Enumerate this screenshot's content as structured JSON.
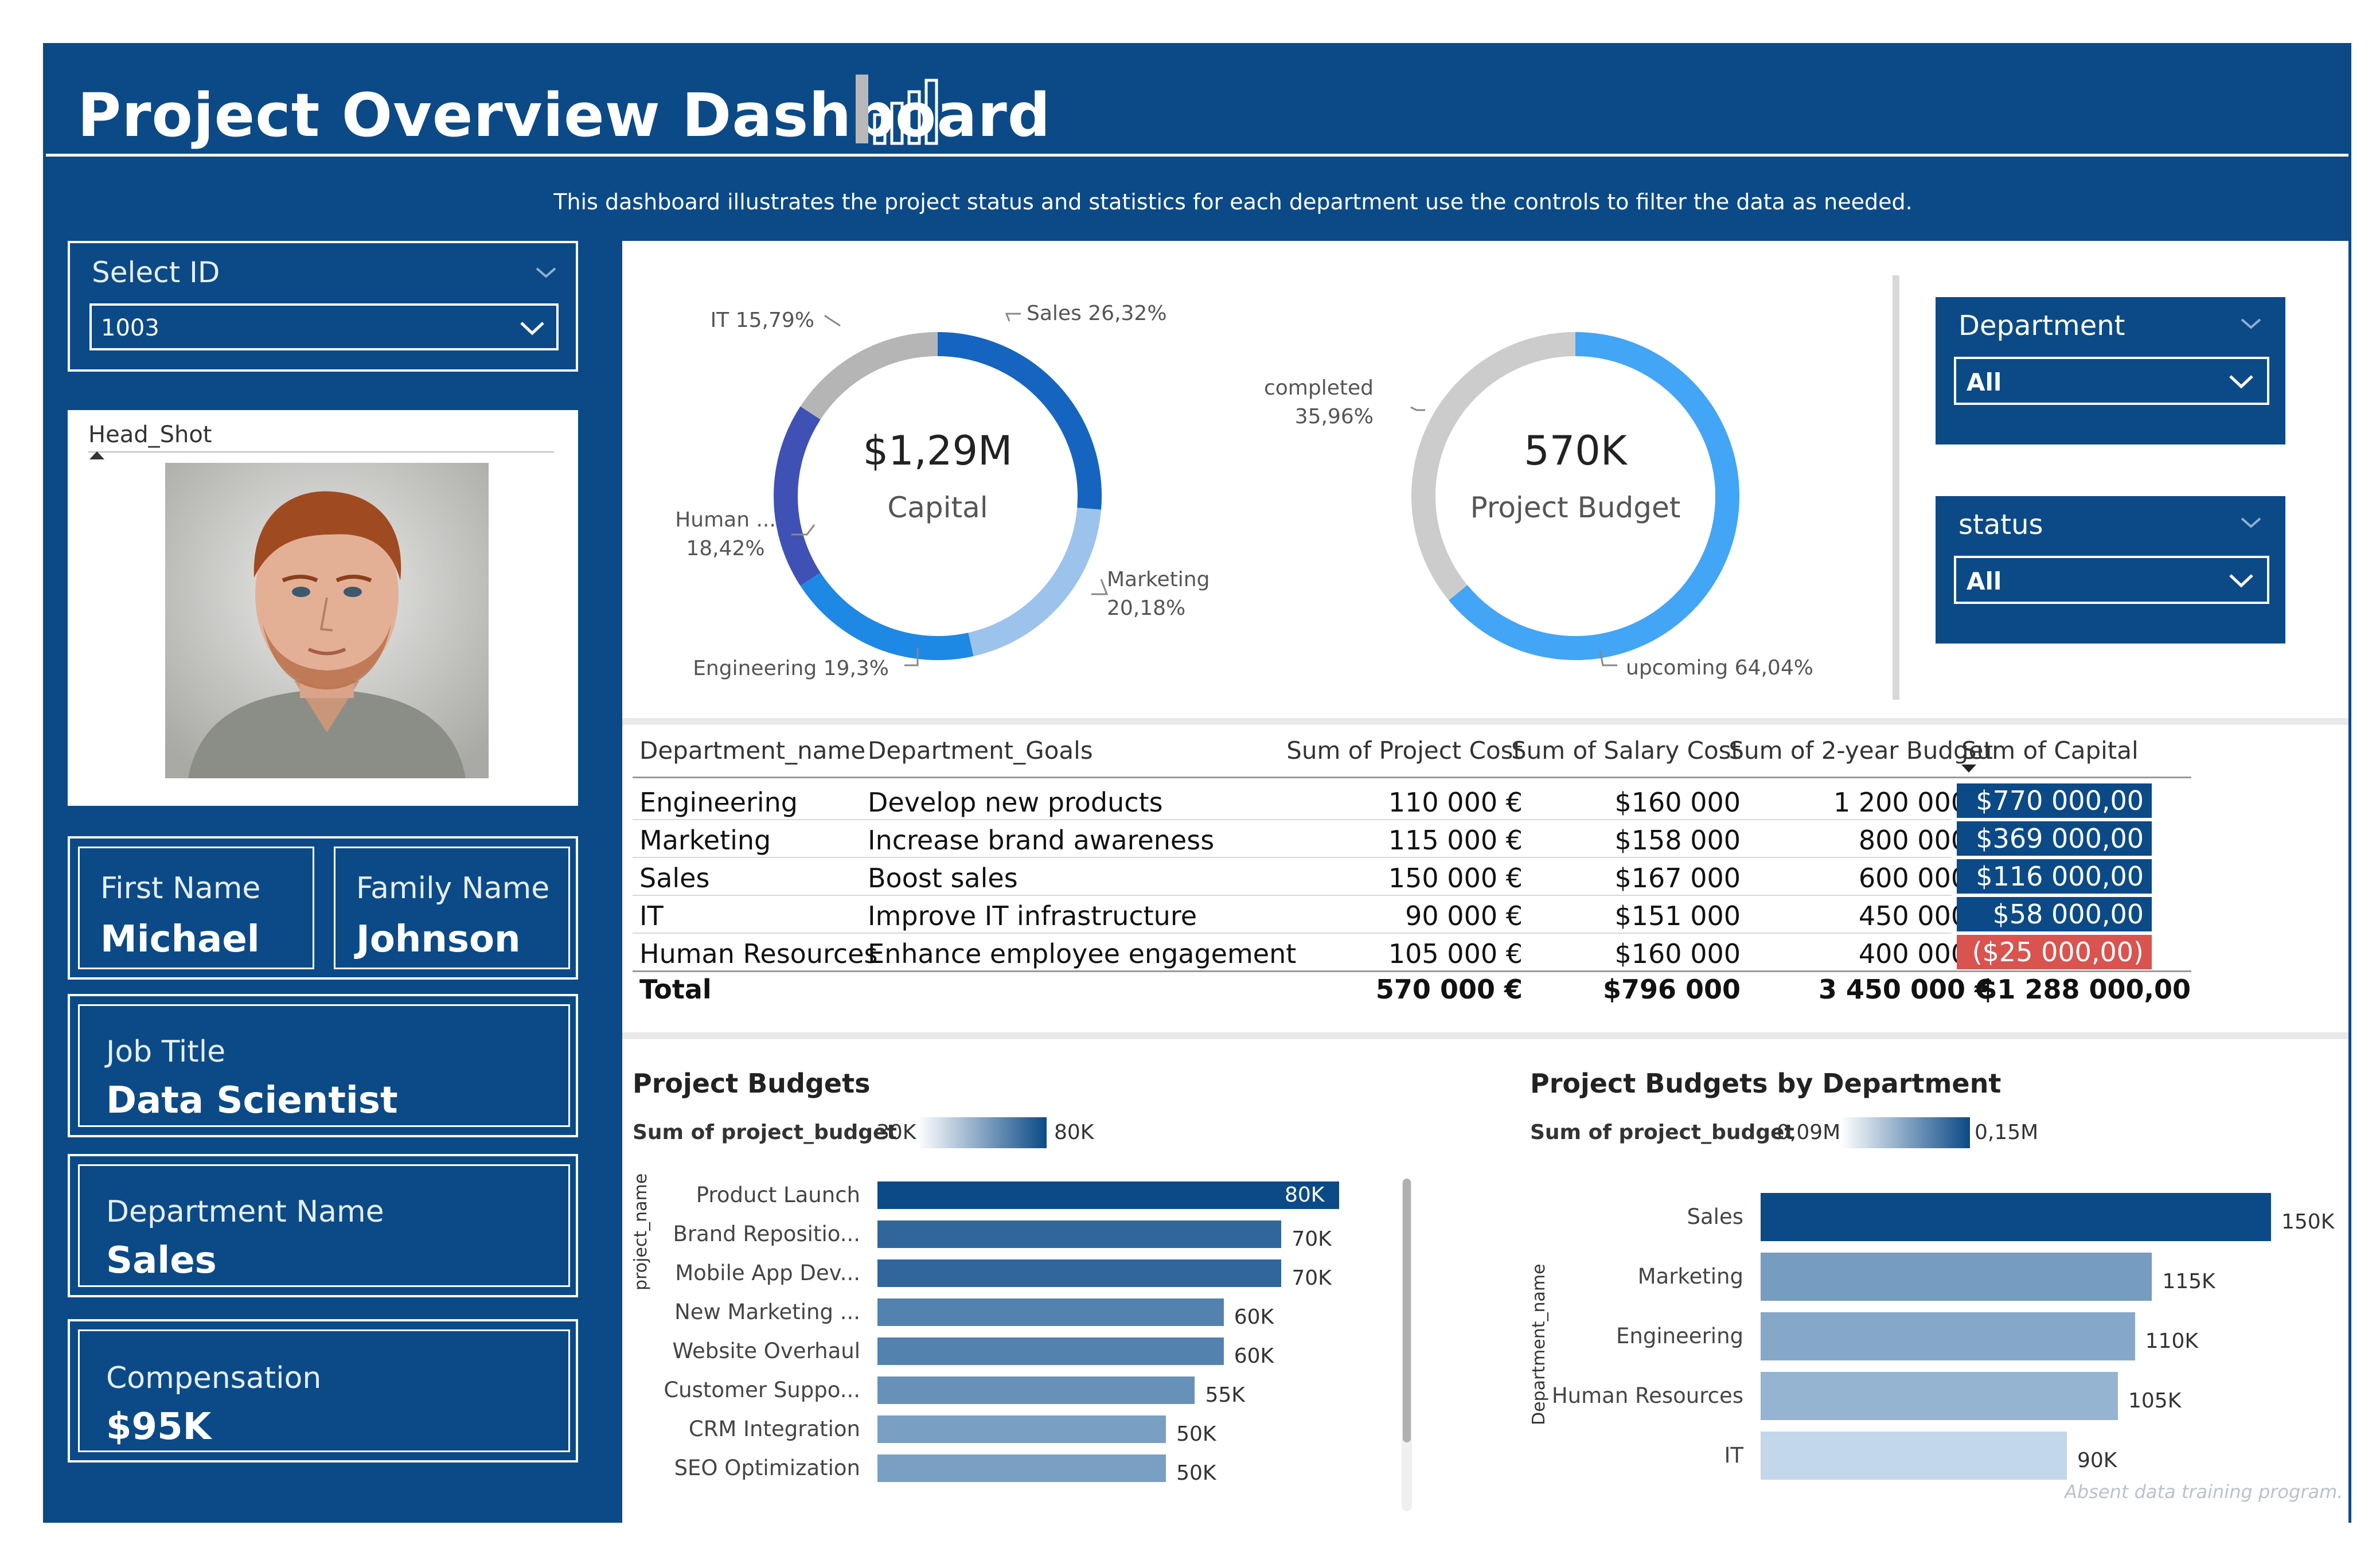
{
  "header": {
    "title": "Project Overview Dashboard",
    "subtitle": "This dashboard illustrates the project status and statistics for each department use the controls to filter the data as needed."
  },
  "select_id": {
    "label": "Select ID",
    "value": "1003"
  },
  "head_shot": {
    "label": "Head_Shot"
  },
  "employee": {
    "first_name_label": "First Name",
    "first_name": "Michael",
    "family_name_label": "Family Name",
    "family_name": "Johnson",
    "job_title_label": "Job Title",
    "job_title": "Data Scientist",
    "department_label": "Department Name",
    "department": "Sales",
    "compensation_label": "Compensation",
    "compensation": "$95K"
  },
  "filters": {
    "department": {
      "label": "Department",
      "value": "All"
    },
    "status": {
      "label": "status",
      "value": "All"
    }
  },
  "capital_donut": {
    "center_value": "$1,29M",
    "center_label": "Capital",
    "labels": {
      "sales": "Sales 26,32%",
      "marketing_1": "Marketing",
      "marketing_2": "20,18%",
      "engineering": "Engineering 19,3%",
      "human_1": "Human ...",
      "human_2": "18,42%",
      "it": "IT 15,79%"
    }
  },
  "budget_donut": {
    "center_value": "570K",
    "center_label": "Project Budget",
    "labels": {
      "completed_1": "completed",
      "completed_2": "35,96%",
      "upcoming": "upcoming 64,04%"
    }
  },
  "table": {
    "headers": [
      "Department_name",
      "Department_Goals",
      "Sum of Project Cost",
      "Sum of Salary Cost",
      "Sum of 2-year Budget",
      "Sum of Capital"
    ],
    "rows": [
      [
        "Engineering",
        "Develop new products",
        "110 000 €",
        "$160 000",
        "1 200 000 €",
        "$770 000,00"
      ],
      [
        "Marketing",
        "Increase brand awareness",
        "115 000 €",
        "$158 000",
        "800 000 €",
        "$369 000,00"
      ],
      [
        "Sales",
        "Boost sales",
        "150 000 €",
        "$167 000",
        "600 000 €",
        "$116 000,00"
      ],
      [
        "IT",
        "Improve IT infrastructure",
        "90 000 €",
        "$151 000",
        "450 000 €",
        "$58 000,00"
      ],
      [
        "Human Resources",
        "Enhance employee engagement",
        "105 000 €",
        "$160 000",
        "400 000 €",
        "($25 000,00)"
      ]
    ],
    "total": [
      "Total",
      "",
      "570 000 €",
      "$796 000",
      "3 450 000 €",
      "$1 288 000,00"
    ],
    "negative_color": "#d9534f"
  },
  "project_budgets": {
    "title": "Project Budgets",
    "legend_label": "Sum of project_budget",
    "legend_min": "30K",
    "legend_max": "80K",
    "axis_label": "project_name"
  },
  "dept_budgets": {
    "title": "Project Budgets by Department",
    "legend_label": "Sum of project_budget",
    "legend_min": "0,09M",
    "legend_max": "0,15M",
    "axis_label": "Department_name",
    "watermark": "Absent data training program."
  },
  "chart_data": [
    {
      "type": "pie",
      "title": "Capital",
      "categories": [
        "Sales",
        "Marketing",
        "Engineering",
        "Human Resources",
        "IT"
      ],
      "values": [
        26.32,
        20.18,
        19.3,
        18.42,
        15.79
      ],
      "colors": [
        "#1565c0",
        "#9cc3ec",
        "#1e88e5",
        "#3f51b5",
        "#b5b5b5"
      ]
    },
    {
      "type": "pie",
      "title": "Project Budget",
      "categories": [
        "upcoming",
        "completed"
      ],
      "values": [
        64.04,
        35.96
      ],
      "colors": [
        "#42a5f5",
        "#cccccc"
      ]
    },
    {
      "type": "bar",
      "title": "Project Budgets",
      "orientation": "horizontal",
      "categories": [
        "Product Launch",
        "Brand Repositio...",
        "Mobile App Dev...",
        "New Marketing ...",
        "Website Overhaul",
        "Customer Suppo...",
        "CRM Integration",
        "SEO Optimization"
      ],
      "values": [
        80,
        70,
        70,
        60,
        60,
        55,
        50,
        50
      ],
      "value_labels": [
        "80K",
        "70K",
        "70K",
        "60K",
        "60K",
        "55K",
        "50K",
        "50K"
      ],
      "ylabel": "project_name",
      "color_range": [
        "#e3f0fc",
        "#0b4a87"
      ],
      "color_domain": [
        30,
        80
      ]
    },
    {
      "type": "bar",
      "title": "Project Budgets by Department",
      "orientation": "horizontal",
      "categories": [
        "Sales",
        "Marketing",
        "Engineering",
        "Human Resources",
        "IT"
      ],
      "values": [
        150,
        115,
        110,
        105,
        90
      ],
      "value_labels": [
        "150K",
        "115K",
        "110K",
        "105K",
        "90K"
      ],
      "ylabel": "Department_name",
      "color_range": [
        "#e3f0fc",
        "#0b4a87"
      ],
      "color_domain": [
        90,
        150
      ]
    }
  ]
}
